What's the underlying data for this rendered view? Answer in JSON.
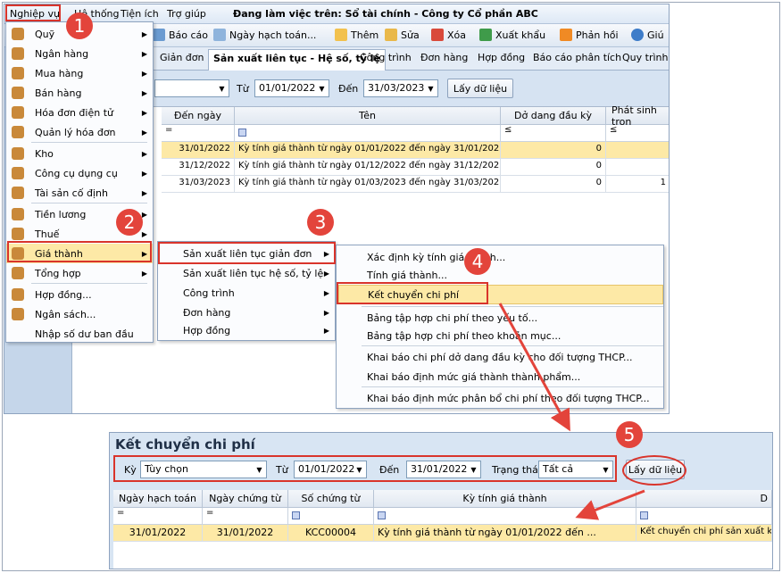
{
  "menubar": {
    "items": [
      "Nghiệp vụ",
      "Hệ thống",
      "Tiện ích",
      "Trợ giúp"
    ],
    "workspace": "Đang làm việc trên: Sổ tài chính - Công ty Cổ phần ABC"
  },
  "toolbar": {
    "report": "Báo cáo",
    "posting_date": "Ngày hạch toán...",
    "add": "Thêm",
    "edit": "Sửa",
    "delete": "Xóa",
    "export": "Xuất khẩu",
    "feedback": "Phản hồi",
    "help": "Giú"
  },
  "tabs": [
    "Giản đơn",
    "Sản xuất liên tục - Hệ số, tỷ lệ",
    "Công trình",
    "Đơn hàng",
    "Hợp đồng",
    "Báo cáo phân tích",
    "Quy trình"
  ],
  "filter": {
    "from_label": "Từ",
    "from_value": "01/01/2022",
    "to_label": "Đến",
    "to_value": "31/03/2023",
    "fetch": "Lấy dữ liệu"
  },
  "grid": {
    "headers": [
      "Đến ngày",
      "Tên",
      "Dở dang đầu kỳ",
      "Phát sinh tron"
    ],
    "filter_ops": [
      "=",
      "",
      "≤",
      "≤"
    ],
    "rows": [
      {
        "to": "31/01/2022",
        "name": "Kỳ tính giá thành từ ngày 01/01/2022 đến ngày 31/01/2022",
        "wip": "0",
        "arise": ""
      },
      {
        "to": "31/12/2022",
        "name": "Kỳ tính giá thành từ ngày 01/12/2022 đến ngày 31/12/2022",
        "wip": "0",
        "arise": ""
      },
      {
        "to": "31/03/2023",
        "name": "Kỳ tính giá thành từ ngày 01/03/2023 đến ngày 31/03/2023",
        "wip": "0",
        "arise": "1"
      }
    ]
  },
  "main_menu": [
    {
      "label": "Quỹ",
      "icon": "cash-icon",
      "sub": true
    },
    {
      "label": "Ngân hàng",
      "icon": "bank-icon",
      "sub": true
    },
    {
      "label": "Mua hàng",
      "icon": "purchase-icon",
      "sub": true
    },
    {
      "label": "Bán hàng",
      "icon": "sales-icon",
      "sub": true
    },
    {
      "label": "Hóa đơn điện tử",
      "icon": "einvoice-icon",
      "sub": true
    },
    {
      "label": "Quản lý hóa đơn",
      "icon": "invoice-icon",
      "sub": true
    },
    {
      "label": "Kho",
      "icon": "warehouse-icon",
      "sub": true
    },
    {
      "label": "Công cụ dụng cụ",
      "icon": "tools-icon",
      "sub": true
    },
    {
      "label": "Tài sản cố định",
      "icon": "asset-icon",
      "sub": true
    },
    {
      "label": "Tiền lương",
      "icon": "salary-icon",
      "sub": true
    },
    {
      "label": "Thuế",
      "icon": "tax-icon",
      "sub": true
    },
    {
      "label": "Giá thành",
      "icon": "cost-icon",
      "sub": true
    },
    {
      "label": "Tổng hợp",
      "icon": "summary-icon",
      "sub": true
    },
    {
      "label": "Hợp đồng...",
      "icon": "contract-icon",
      "sub": false
    },
    {
      "label": "Ngân sách...",
      "icon": "budget-icon",
      "sub": false
    },
    {
      "label": "Nhập số dư ban đầu",
      "icon": "",
      "sub": false
    }
  ],
  "sub_menu": [
    "Sản xuất liên tục giản đơn",
    "Sản xuất liên tục hệ số, tỷ lệ",
    "Công trình",
    "Đơn hàng",
    "Hợp đồng"
  ],
  "sub_sub_menu": [
    "Xác định kỳ tính giá thành...",
    "Tính giá thành...",
    "Kết chuyển chi phí",
    "Bảng tập hợp chi phí theo yếu tố...",
    "Bảng tập hợp chi phí theo khoản mục...",
    "Khai báo chi phí dở dang đầu kỳ cho đối tượng THCP...",
    "Khai báo định mức giá thành thành phẩm...",
    "Khai báo định mức phân bổ chi phí theo đối tượng THCP..."
  ],
  "badges": [
    "1",
    "2",
    "3",
    "4",
    "5"
  ],
  "dialog": {
    "title": "Kết chuyển chi phí",
    "period_label": "Kỳ",
    "period_value": "Tùy chọn",
    "from_label": "Từ",
    "from_value": "01/01/2022",
    "to_label": "Đến",
    "to_value": "31/01/2022",
    "status_label": "Trạng thái",
    "status_value": "Tất cả",
    "fetch": "Lấy dữ liệu",
    "headers": [
      "Ngày hạch toán",
      "Ngày chứng từ",
      "Số chứng từ",
      "Kỳ tính giá thành",
      "D"
    ],
    "filter_ops": [
      "=",
      "="
    ],
    "row": {
      "posting_date": "31/01/2022",
      "doc_date": "31/01/2022",
      "doc_no": "KCC00004",
      "period": "Kỳ tính giá thành từ ngày 01/01/2022 đến ...",
      "desc": "Kết chuyển chi phí sản xuất kỳ"
    }
  },
  "colors": {
    "accent_red": "#d9342b",
    "highlight": "#fde9a6",
    "grid_header": "#e1e8f1"
  }
}
